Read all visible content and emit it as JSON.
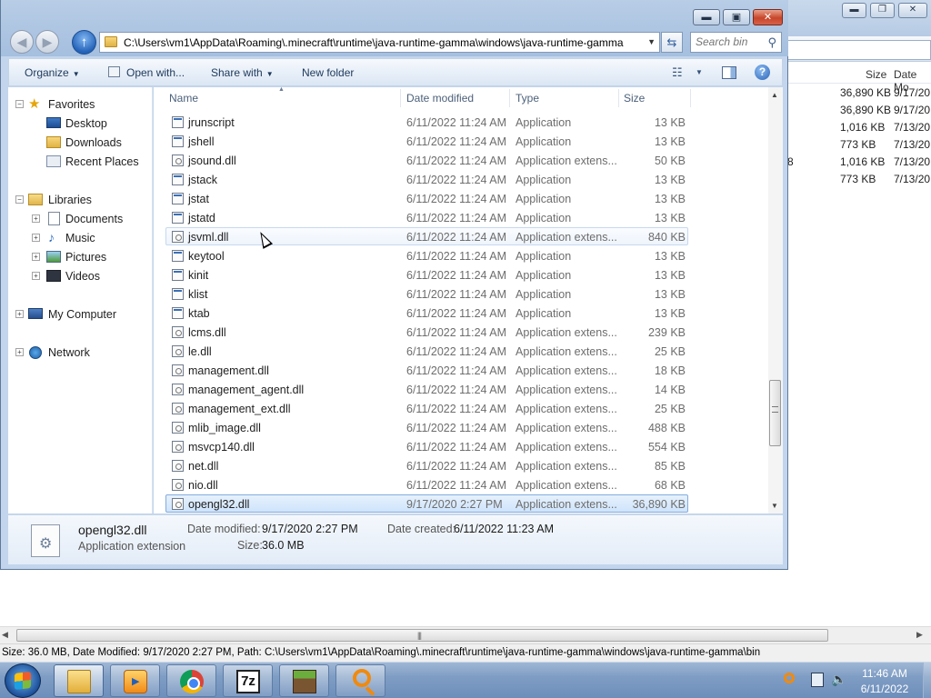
{
  "background_window": {
    "headers": {
      "size": "Size",
      "date": "Date Mo"
    },
    "rows": [
      {
        "size": "36,890 KB",
        "date": "9/17/20",
        "prefix": ""
      },
      {
        "size": "36,890 KB",
        "date": "9/17/20",
        "prefix": ""
      },
      {
        "size": "1,016 KB",
        "date": "7/13/20",
        "prefix": ""
      },
      {
        "size": "773 KB",
        "date": "7/13/20",
        "prefix": ""
      },
      {
        "size": "1,016 KB",
        "date": "7/13/20",
        "prefix": "8"
      },
      {
        "size": "773 KB",
        "date": "7/13/20",
        "prefix": ""
      }
    ],
    "status_text": "Size: 36.0 MB, Date Modified: 9/17/2020 2:27 PM, Path: C:\\Users\\vm1\\AppData\\Roaming\\.minecraft\\runtime\\java-runtime-gamma\\windows\\java-runtime-gamma\\bin"
  },
  "window": {
    "caption": {
      "minimize": "▬",
      "maximize": "▣",
      "close": "✕"
    }
  },
  "address": {
    "path": "C:\\Users\\vm1\\AppData\\Roaming\\.minecraft\\runtime\\java-runtime-gamma\\windows\\java-runtime-gamma",
    "search_placeholder": "Search bin"
  },
  "commands": {
    "organize": "Organize",
    "open_with": "Open with...",
    "share_with": "Share with",
    "new_folder": "New folder"
  },
  "nav": {
    "favorites": "Favorites",
    "desktop": "Desktop",
    "downloads": "Downloads",
    "recent_places": "Recent Places",
    "libraries": "Libraries",
    "documents": "Documents",
    "music": "Music",
    "pictures": "Pictures",
    "videos": "Videos",
    "my_computer": "My Computer",
    "network": "Network"
  },
  "columns": {
    "name": "Name",
    "date": "Date modified",
    "type": "Type",
    "size": "Size"
  },
  "files": [
    {
      "name": "jrunscript",
      "date": "6/11/2022 11:24 AM",
      "type": "Application",
      "size": "13 KB",
      "kind": "app"
    },
    {
      "name": "jshell",
      "date": "6/11/2022 11:24 AM",
      "type": "Application",
      "size": "13 KB",
      "kind": "app"
    },
    {
      "name": "jsound.dll",
      "date": "6/11/2022 11:24 AM",
      "type": "Application extens...",
      "size": "50 KB",
      "kind": "dll"
    },
    {
      "name": "jstack",
      "date": "6/11/2022 11:24 AM",
      "type": "Application",
      "size": "13 KB",
      "kind": "app"
    },
    {
      "name": "jstat",
      "date": "6/11/2022 11:24 AM",
      "type": "Application",
      "size": "13 KB",
      "kind": "app"
    },
    {
      "name": "jstatd",
      "date": "6/11/2022 11:24 AM",
      "type": "Application",
      "size": "13 KB",
      "kind": "app"
    },
    {
      "name": "jsvml.dll",
      "date": "6/11/2022 11:24 AM",
      "type": "Application extens...",
      "size": "840 KB",
      "kind": "dll",
      "state": "hover"
    },
    {
      "name": "keytool",
      "date": "6/11/2022 11:24 AM",
      "type": "Application",
      "size": "13 KB",
      "kind": "app"
    },
    {
      "name": "kinit",
      "date": "6/11/2022 11:24 AM",
      "type": "Application",
      "size": "13 KB",
      "kind": "app"
    },
    {
      "name": "klist",
      "date": "6/11/2022 11:24 AM",
      "type": "Application",
      "size": "13 KB",
      "kind": "app"
    },
    {
      "name": "ktab",
      "date": "6/11/2022 11:24 AM",
      "type": "Application",
      "size": "13 KB",
      "kind": "app"
    },
    {
      "name": "lcms.dll",
      "date": "6/11/2022 11:24 AM",
      "type": "Application extens...",
      "size": "239 KB",
      "kind": "dll"
    },
    {
      "name": "le.dll",
      "date": "6/11/2022 11:24 AM",
      "type": "Application extens...",
      "size": "25 KB",
      "kind": "dll"
    },
    {
      "name": "management.dll",
      "date": "6/11/2022 11:24 AM",
      "type": "Application extens...",
      "size": "18 KB",
      "kind": "dll"
    },
    {
      "name": "management_agent.dll",
      "date": "6/11/2022 11:24 AM",
      "type": "Application extens...",
      "size": "14 KB",
      "kind": "dll"
    },
    {
      "name": "management_ext.dll",
      "date": "6/11/2022 11:24 AM",
      "type": "Application extens...",
      "size": "25 KB",
      "kind": "dll"
    },
    {
      "name": "mlib_image.dll",
      "date": "6/11/2022 11:24 AM",
      "type": "Application extens...",
      "size": "488 KB",
      "kind": "dll"
    },
    {
      "name": "msvcp140.dll",
      "date": "6/11/2022 11:24 AM",
      "type": "Application extens...",
      "size": "554 KB",
      "kind": "dll"
    },
    {
      "name": "net.dll",
      "date": "6/11/2022 11:24 AM",
      "type": "Application extens...",
      "size": "85 KB",
      "kind": "dll"
    },
    {
      "name": "nio.dll",
      "date": "6/11/2022 11:24 AM",
      "type": "Application extens...",
      "size": "68 KB",
      "kind": "dll"
    },
    {
      "name": "opengl32.dll",
      "date": "9/17/2020 2:27 PM",
      "type": "Application extens...",
      "size": "36,890 KB",
      "kind": "dll",
      "state": "selected"
    }
  ],
  "details": {
    "name": "opengl32.dll",
    "type": "Application extension",
    "modified_label": "Date modified:",
    "modified_value": "9/17/2020 2:27 PM",
    "created_label": "Date created:",
    "created_value": "6/11/2022 11:23 AM",
    "size_label": "Size:",
    "size_value": "36.0 MB"
  },
  "taskbar": {
    "apps": [
      "windows-explorer",
      "media-player",
      "chrome",
      "7-zip",
      "minecraft",
      "search-tool"
    ],
    "active_app": "windows-explorer",
    "seven_zip_label": "7z"
  },
  "clock": {
    "time": "11:46 AM",
    "date": "6/11/2022"
  }
}
